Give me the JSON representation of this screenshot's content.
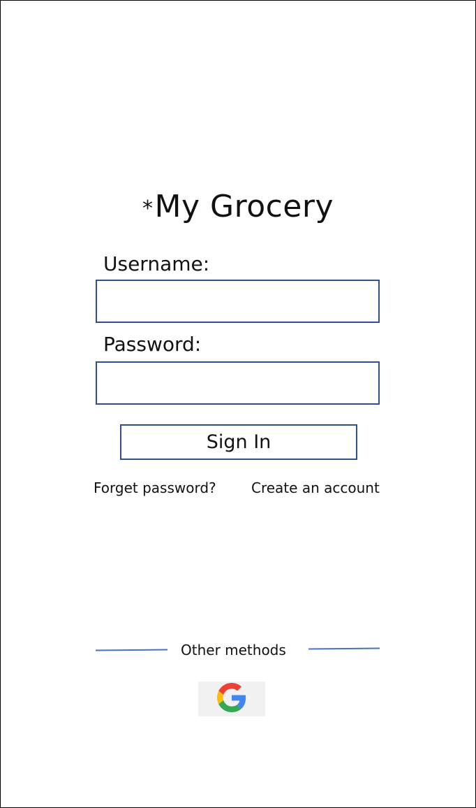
{
  "app": {
    "title_star": "*",
    "title": "My Grocery"
  },
  "form": {
    "username_label": "Username:",
    "username_value": "",
    "password_label": "Password:",
    "password_value": "",
    "signin_label": "Sign In"
  },
  "links": {
    "forget_password": "Forget password?",
    "create_account": "Create an account"
  },
  "other_methods": {
    "label": "Other methods",
    "providers": [
      {
        "icon": "google-icon"
      }
    ]
  },
  "colors": {
    "accent": "#2f4f8f",
    "divider": "#4472c4",
    "google_bg": "#f1f1f1"
  }
}
